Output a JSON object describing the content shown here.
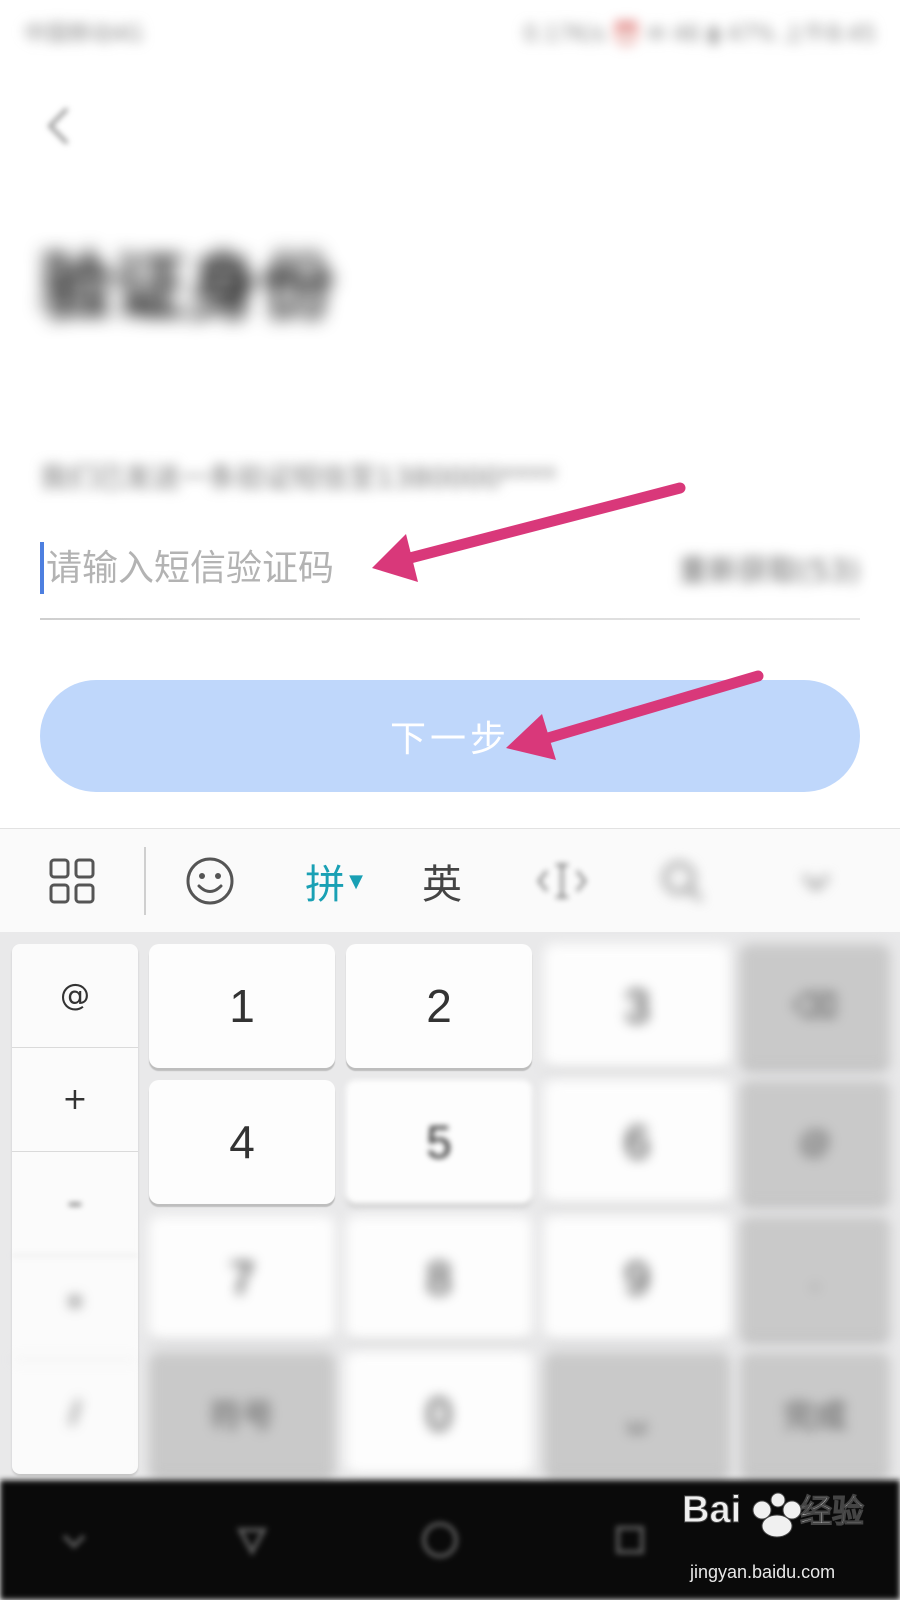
{
  "status_bar": {
    "left_text": "中国移动4G",
    "right_text": "0.17K/s  ⏰ ✉ 46 ▮ 47%  上午8:45"
  },
  "header": {
    "back_icon": "chevron-left-icon",
    "title": "验证身份"
  },
  "form": {
    "info_text": "我们已发送一条验证短信至1380000****",
    "code_placeholder": "请输入短信验证码",
    "code_value": "",
    "resend_label": "重新获取(53)",
    "next_label": "下一步",
    "next_color": "#bfd7fb"
  },
  "annotations": {
    "arrow_color": "#d9387a"
  },
  "keyboard_toolbar": {
    "menu_icon": "grid-icon",
    "emoji_icon": "smiley-icon",
    "pinyin_label": "拼",
    "english_label": "英",
    "cursor_icon": "cursor-move-icon",
    "search_icon": "search-icon",
    "collapse_icon": "chevron-down-icon",
    "accent_color": "#19a0b4"
  },
  "keyboard": {
    "side_keys": [
      "@",
      "+",
      "–",
      "*",
      "/"
    ],
    "number_keys": [
      "1",
      "2",
      "3",
      "4",
      "5",
      "6",
      "7",
      "8",
      "9"
    ],
    "delete_label": "⌫",
    "at_label": "@",
    "dot_label": ".",
    "symbols_label": "符号",
    "zero_label": "0",
    "space_label": "␣",
    "enter_label": "完成"
  },
  "nav_bar": {
    "items": [
      "menu-icon",
      "home-icon",
      "circle-icon",
      "back-icon"
    ]
  },
  "watermark": {
    "brand": "Baidu经验",
    "url": "jingyan.baidu.com"
  }
}
